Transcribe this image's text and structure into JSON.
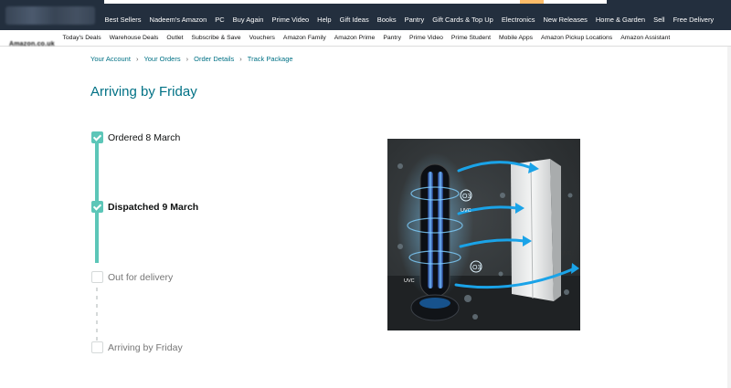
{
  "top_nav": {
    "links": [
      "Best Sellers",
      "Nadeem's Amazon",
      "PC",
      "Buy Again",
      "Prime Video",
      "Help",
      "Gift Ideas",
      "Books",
      "Pantry",
      "Gift Cards & Top Up",
      "Electronics",
      "New Releases",
      "Home & Garden",
      "Sell",
      "Free Delivery"
    ]
  },
  "sub_nav": {
    "logo_text": "Amazon.co.uk",
    "links": [
      "Today's Deals",
      "Warehouse Deals",
      "Outlet",
      "Subscribe & Save",
      "Vouchers",
      "Amazon Family",
      "Amazon Prime",
      "Pantry",
      "Prime Video",
      "Prime Student",
      "Mobile Apps",
      "Amazon Pickup Locations",
      "Amazon Assistant"
    ]
  },
  "breadcrumb": [
    "Your Account",
    "Your Orders",
    "Order Details",
    "Track Package"
  ],
  "breadcrumb_separator": "›",
  "page_title": "Arriving by Friday",
  "timeline": [
    {
      "label": "Ordered 8 March",
      "status": "done"
    },
    {
      "label": "Dispatched 9 March",
      "status": "current"
    },
    {
      "label": "Out for delivery",
      "status": "pending"
    },
    {
      "label": "Arriving by Friday",
      "status": "pending"
    }
  ],
  "product_image": {
    "labels": {
      "uvc_top": "UVC",
      "uvc_left": "UVC",
      "uvc_right": "UVC",
      "o3": "O3"
    }
  },
  "colors": {
    "nav_bg": "#232f3e",
    "link": "#007185",
    "timeline": "#5cc6b8",
    "pending": "#d5d9d9"
  }
}
